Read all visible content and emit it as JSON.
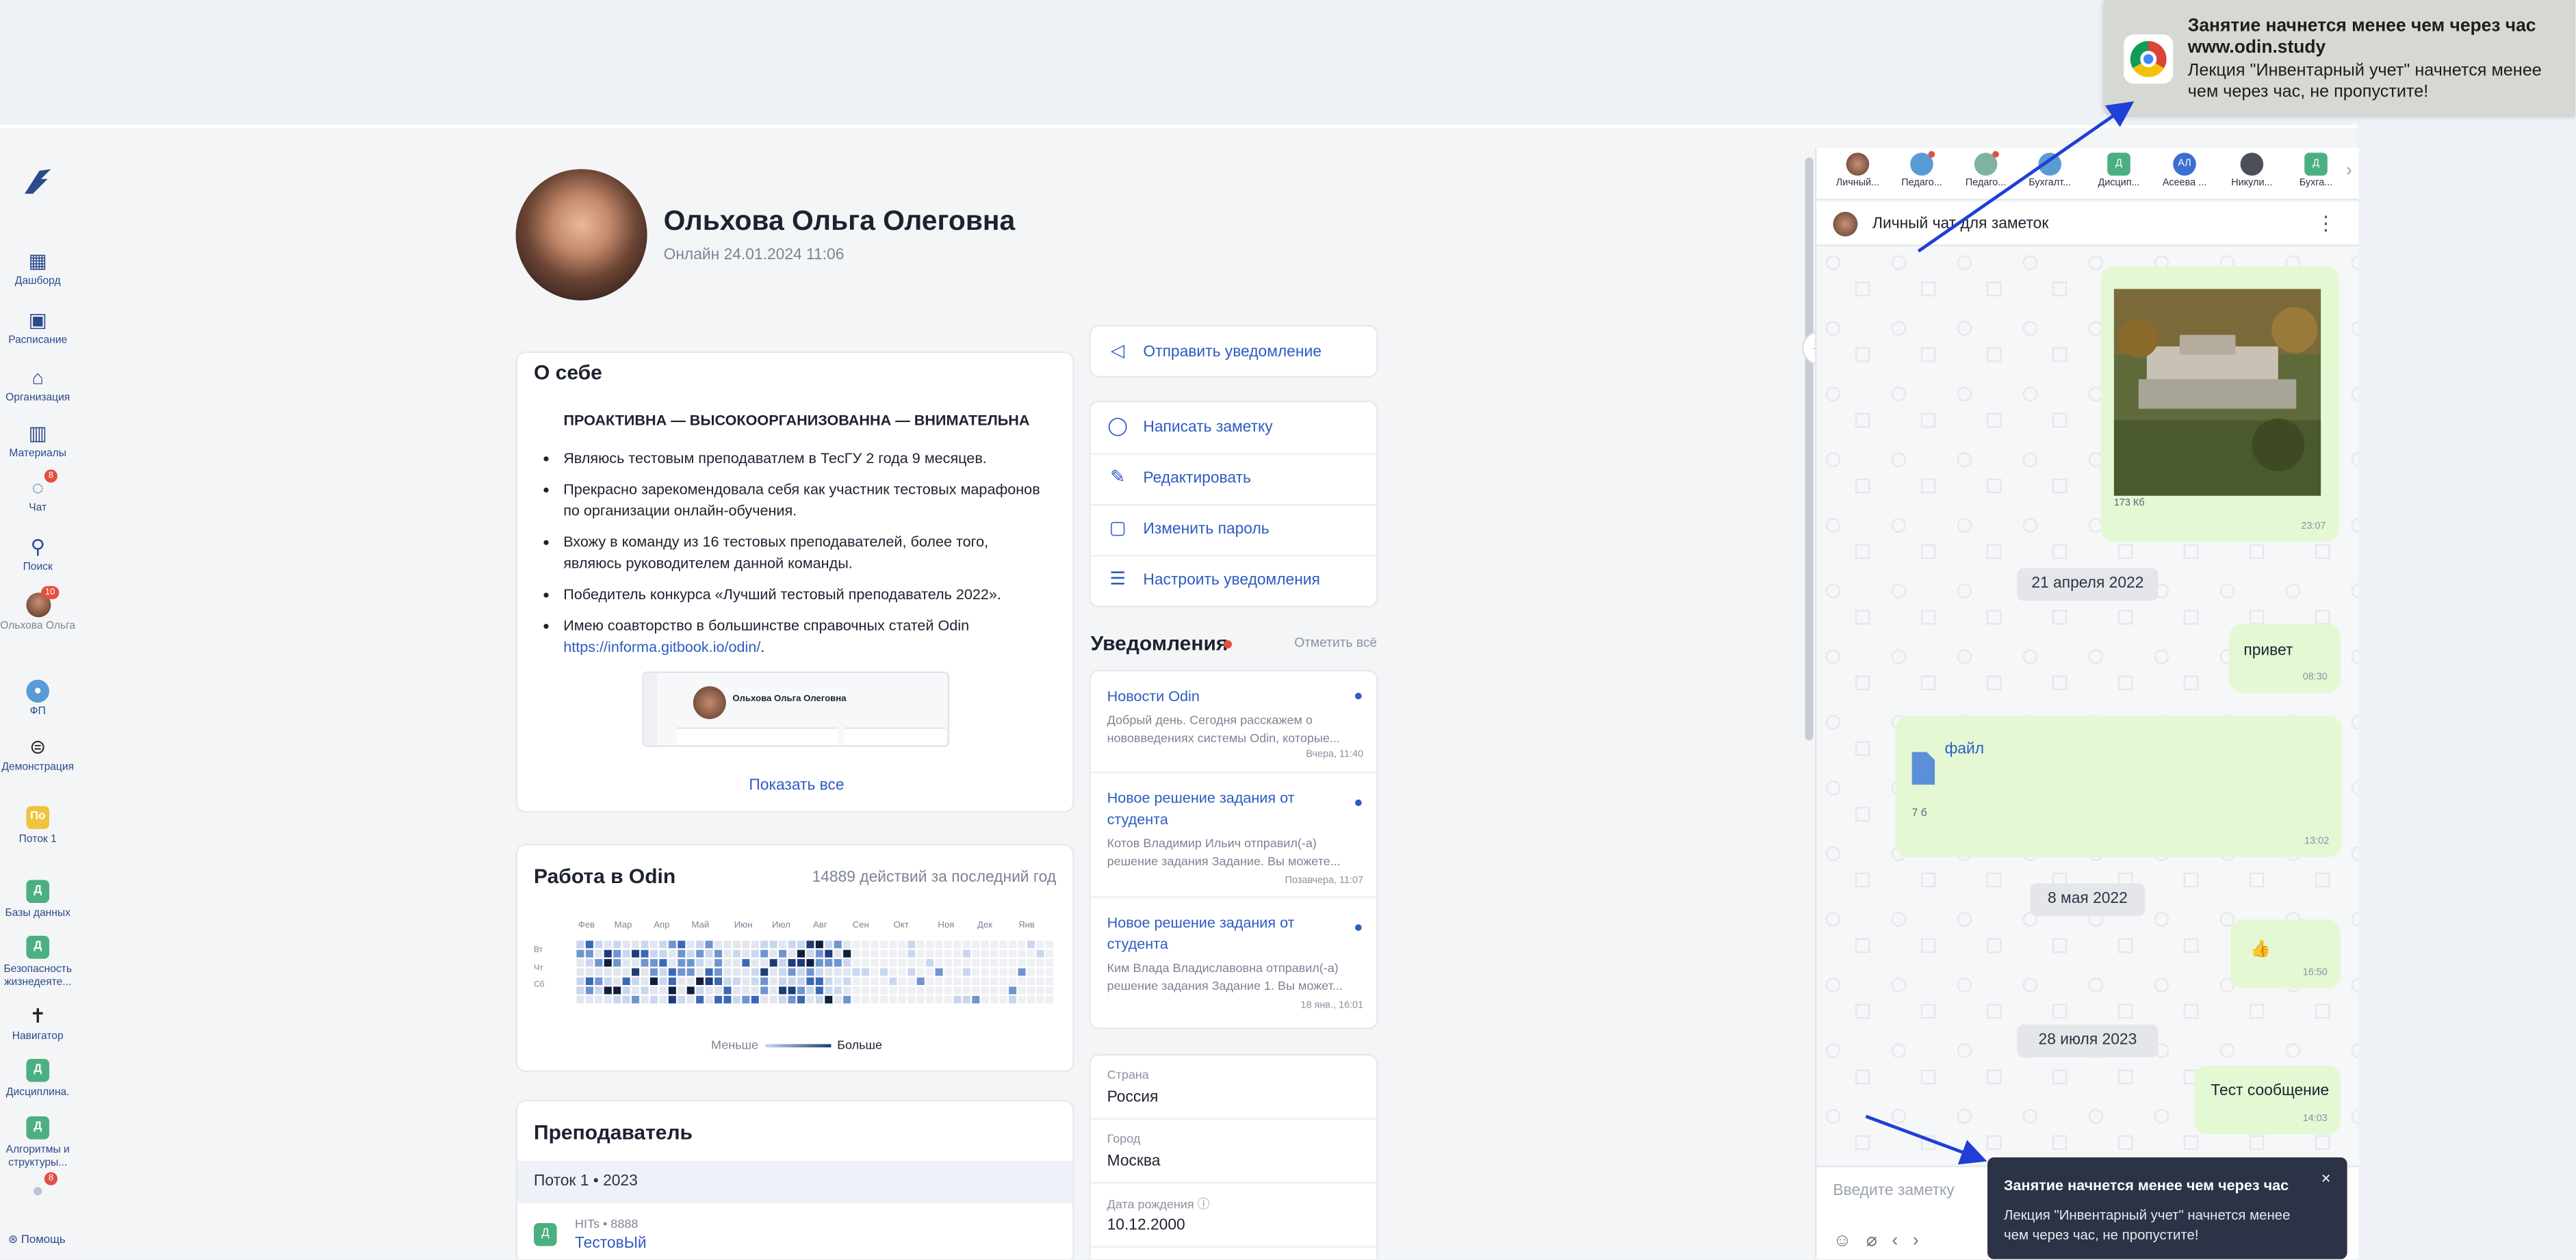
{
  "sidebar": {
    "items": [
      {
        "label": "Дашборд",
        "icon": "grid-icon"
      },
      {
        "label": "Расписание",
        "icon": "calendar-icon"
      },
      {
        "label": "Организация",
        "icon": "home-icon"
      },
      {
        "label": "Материалы",
        "icon": "book-icon"
      },
      {
        "label": "Чат",
        "icon": "chat-icon",
        "badge": "8"
      },
      {
        "label": "Поиск",
        "icon": "search-icon"
      },
      {
        "label": "Ольхова Ольга",
        "icon": "user-avatar",
        "badge": "10"
      },
      {
        "label": "ФП",
        "icon": "fp-icon"
      },
      {
        "label": "Демонстрация",
        "icon": "demo-icon"
      },
      {
        "label": "Поток 1",
        "short": "По",
        "color": "#f0c33c"
      },
      {
        "label": "Базы данных",
        "short": "Д",
        "color": "#4caf82"
      },
      {
        "label": "Безопасность жизнедеяте...",
        "short": "Д",
        "color": "#4caf82"
      },
      {
        "label": "Навигатор",
        "icon": "cross-icon"
      },
      {
        "label": "Дисциплина.",
        "short": "Д",
        "color": "#4caf82"
      },
      {
        "label": "Алгоритмы и структуры...",
        "short": "Д",
        "color": "#4caf82"
      }
    ],
    "extra_badge": "8",
    "help": "Помощь"
  },
  "profile": {
    "name": "Ольхова Ольга Олеговна",
    "online": "Онлайн 24.01.2024 11:06"
  },
  "about": {
    "title": "О себе",
    "headline": "ПРОАКТИВНА — ВЫСОКООРГАНИЗОВАННА — ВНИМАТЕЛЬНА",
    "bullets": [
      "Являюсь тестовым преподаватлем в ТесГУ 2 года 9 месяцев.",
      "Прекрасно зарекомендовала себя как участник тестовых марафонов по организации онлайн-обучения.",
      "Вхожу в команду из 16 тестовых преподавателей, более того, являюсь руководителем данной команды.",
      "Победитель конкурса «Лучший тестовый преподаватель 2022».",
      "Имею соавторство в большинстве справочных статей Odin"
    ],
    "link": "https://informa.gitbook.io/odin/",
    "link_suffix": ".",
    "thumb_name": "Ольхова Ольга Олеговна",
    "show_all": "Показать все"
  },
  "work": {
    "title": "Работа в Odin",
    "count": "14889 действий за последний год",
    "months": [
      "Фев",
      "Мар",
      "Апр",
      "Май",
      "Июн",
      "Июл",
      "Авг",
      "Сен",
      "Окт",
      "Ноя",
      "Дек",
      "Янв"
    ],
    "days": [
      "Вт",
      "Чт",
      "Сб"
    ],
    "legend_less": "Меньше",
    "legend_more": "Больше"
  },
  "teacher": {
    "title": "Преподаватель",
    "stream": "Поток 1 • 2023",
    "meta": "HITs • 8888",
    "name": "ТестовЫй",
    "short": "Д"
  },
  "actions": {
    "send_notification": "Отправить уведомление",
    "write_note": "Написать заметку",
    "edit": "Редактировать",
    "change_password": "Изменить пароль",
    "setup_notifications": "Настроить уведомления"
  },
  "notifications": {
    "title": "Уведомления",
    "mark_all": "Отметить всё",
    "items": [
      {
        "title": "Новости Odin",
        "body": "Добрый день. Сегодня расскажем о нововведениях системы Odin, которые...",
        "time": "Вчера, 11:40"
      },
      {
        "title": "Новое решение задания от студента",
        "body": "Котов Владимир Ильич отправил(-а) решение задания Задание. Вы можете...",
        "time": "Позавчера, 11:07"
      },
      {
        "title": "Новое решение задания от студента",
        "body": "Ким Влада Владиславовна отправил(-а) решение задания Задание 1. Вы может...",
        "time": "18 янв., 16:01"
      }
    ]
  },
  "info": {
    "country_label": "Страна",
    "country": "Россия",
    "city_label": "Город",
    "city": "Москва",
    "birth_label": "Дата рождения",
    "birth": "10.12.2000"
  },
  "chat": {
    "tabs": [
      {
        "label": "Личный...",
        "color": "#8c5a46"
      },
      {
        "label": "Педаго...",
        "color": "#5b9bd5"
      },
      {
        "label": "Педаго...",
        "color": "#7fb3a0"
      },
      {
        "label": "Бухгалт...",
        "color": "#5b9bd5"
      },
      {
        "label": "Дисцип...",
        "color": "#4caf82",
        "short": "Д"
      },
      {
        "label": "Асеева ...",
        "color": "#3b6fd1",
        "short": "АЛ"
      },
      {
        "label": "Никули...",
        "color": "#4a4f5a"
      },
      {
        "label": "Бухга...",
        "color": "#4caf82",
        "short": "Д"
      }
    ],
    "header": "Личный чат для заметок",
    "image_size": "173 Кб",
    "image_time": "23:07",
    "date1": "21 апреля 2022",
    "msg1": "привет",
    "msg1_time": "08:30",
    "file_name": "файл",
    "file_size": "7 б",
    "file_time": "13:02",
    "date2": "8 мая 2022",
    "msg2": "👍",
    "msg2_time": "16:50",
    "date3": "28 июля 2023",
    "msg3": "Тест сообщение",
    "msg3_time": "14:03",
    "input_placeholder": "Введите заметку"
  },
  "toast": {
    "title": "Занятие начнется менее чем через час",
    "body": "Лекция \"Инвентарный учет\" начнется менее чем через час, не пропустите!",
    "close": "×"
  },
  "chrome_notification": {
    "title": "Занятие начнется менее чем через час",
    "site": "www.odin.study",
    "body": "Лекция \"Инвентарный учет\" начнется менее чем через час, не пропустите!"
  },
  "colors": {
    "accent": "#2d5bc2",
    "bubble": "#e4f8d4",
    "danger": "#e05043",
    "arrow": "#1f3fd6"
  }
}
